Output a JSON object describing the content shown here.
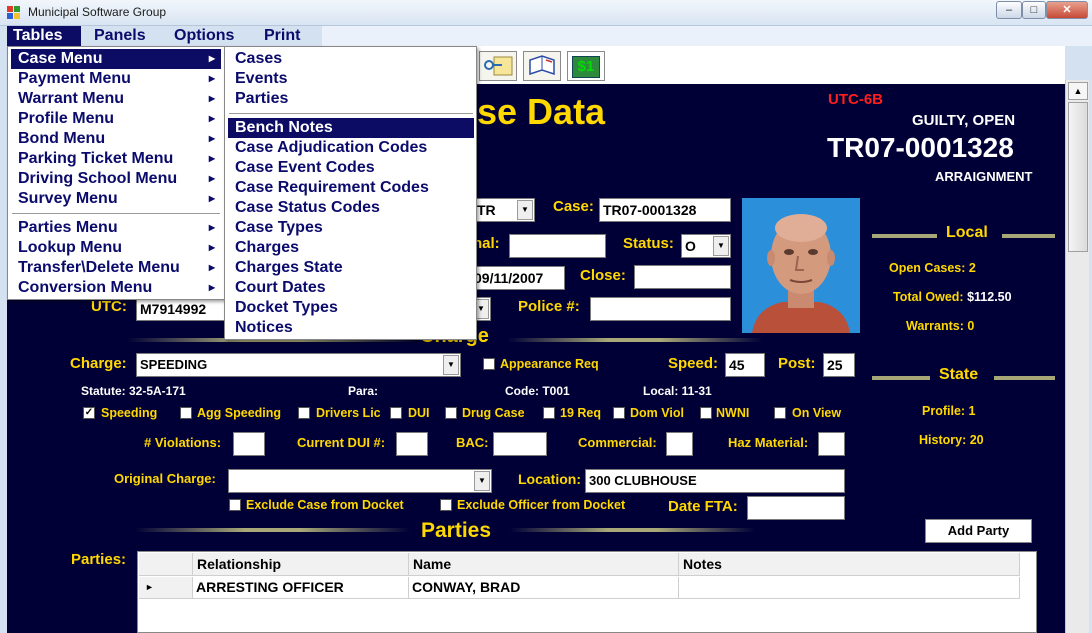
{
  "window": {
    "title": "Municipal Software Group"
  },
  "menubar": {
    "items": [
      "Tables",
      "Panels",
      "Options",
      "Print"
    ]
  },
  "tables_menu": {
    "group1": [
      "Case Menu",
      "Payment Menu",
      "Warrant Menu",
      "Profile Menu",
      "Bond Menu",
      "Parking Ticket Menu",
      "Driving School Menu",
      "Survey Menu"
    ],
    "group2": [
      "Parties Menu",
      "Lookup Menu",
      "Transfer\\Delete Menu",
      "Conversion Menu"
    ]
  },
  "case_menu": {
    "group1": [
      "Cases",
      "Events",
      "Parties"
    ],
    "group2": [
      "Bench Notes",
      "Case Adjudication Codes",
      "Case Event Codes",
      "Case Requirement Codes",
      "Case Status Codes",
      "Case Types",
      "Charges",
      "Charges State",
      "Court Dates",
      "Docket Types",
      "Notices"
    ]
  },
  "toolbar": {
    "money_label": "$1"
  },
  "header": {
    "title": "se Data",
    "utc_code": "UTC-6B",
    "status": "GUILTY,  OPEN",
    "case_number": "TR07-0001328",
    "stage": "ARRAIGNMENT"
  },
  "case_form": {
    "type_value": "TR",
    "case_label": "Case:",
    "case_value": "TR07-0001328",
    "nal_label": "nal:",
    "nal_value": "",
    "status_label": "Status:",
    "status_value": "O",
    "date_value": "09/11/2007",
    "close_label": "Close:",
    "close_value": "",
    "utc_label": "UTC:",
    "utc_value": "M7914992",
    "police_label": "Police #:",
    "police_value": ""
  },
  "charge_section": {
    "title": "Charge",
    "charge_label": "Charge:",
    "charge_value": "SPEEDING",
    "appearance_req": "Appearance Req",
    "speed_label": "Speed:",
    "speed_value": "45",
    "post_label": "Post:",
    "post_value": "25",
    "statute": "Statute: 32-5A-171",
    "para": "Para:",
    "code": "Code: T001",
    "local": "Local: 11-31",
    "checkboxes": [
      {
        "label": "Speeding",
        "checked": true
      },
      {
        "label": "Agg Speeding",
        "checked": false
      },
      {
        "label": "Drivers Lic",
        "checked": false
      },
      {
        "label": "DUI",
        "checked": false
      },
      {
        "label": "Drug Case",
        "checked": false
      },
      {
        "label": "19 Req",
        "checked": false
      },
      {
        "label": "Dom Viol",
        "checked": false
      },
      {
        "label": "NWNI",
        "checked": false
      },
      {
        "label": "On View",
        "checked": false
      }
    ],
    "violations_label": "# Violations:",
    "dui_label": "Current DUI #:",
    "bac_label": "BAC:",
    "commercial_label": "Commercial:",
    "haz_label": "Haz Material:",
    "original_charge_label": "Original Charge:",
    "original_charge_value": "",
    "location_label": "Location:",
    "location_value": "300 CLUBHOUSE",
    "exclude_case": "Exclude Case from Docket",
    "exclude_officer": "Exclude Officer from Docket",
    "date_fta_label": "Date FTA:",
    "date_fta_value": ""
  },
  "local_panel": {
    "title": "Local",
    "open_cases": "Open Cases: 2",
    "total_owed_label": "Total Owed:",
    "total_owed_value": "$112.50",
    "warrants": "Warrants: 0"
  },
  "state_panel": {
    "title": "State",
    "profile": "Profile: 1",
    "history": "History: 20"
  },
  "parties_section": {
    "title": "Parties",
    "label": "Parties:",
    "add_button": "Add Party",
    "columns": [
      "Relationship",
      "Name",
      "Notes"
    ],
    "rows": [
      [
        "ARRESTING OFFICER",
        "CONWAY, BRAD",
        ""
      ]
    ]
  }
}
